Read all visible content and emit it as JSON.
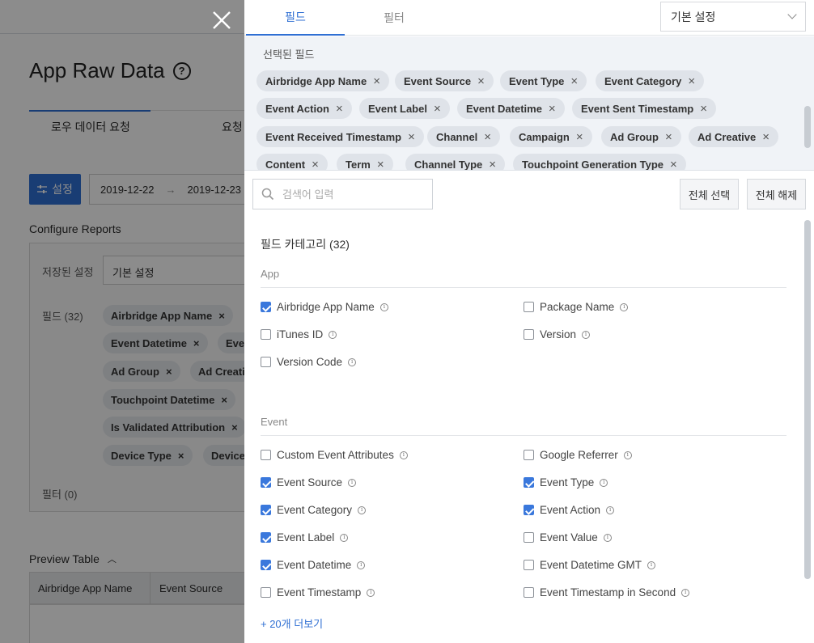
{
  "background": {
    "title": "App Raw Data",
    "tabs": [
      "로우 데이터 요청",
      "요청"
    ],
    "settings_button": "설정",
    "date_start": "2019-12-22",
    "date_end": "2019-12-23",
    "configure_reports": "Configure Reports",
    "saved_settings_label": "저장된 설정",
    "saved_settings_value": "기본 설정",
    "fields_label": "필드 (32)",
    "filter_label": "필터 (0)",
    "chips": [
      "Airbridge App Name",
      "Event Datetime",
      "Even",
      "Ad Group",
      "Ad Creati",
      "Touchpoint Datetime",
      "Is Validated Attribution",
      "Device Type",
      "Device"
    ],
    "preview_table": "Preview Table",
    "table_headers": [
      "Airbridge App Name",
      "Event Source"
    ]
  },
  "drawer": {
    "tabs": [
      "필드",
      "필터"
    ],
    "preset": "기본 설정",
    "selected_label": "선택된 필드",
    "selected_chips": [
      "Airbridge App Name",
      "Event Source",
      "Event Type",
      "Event Category",
      "Event Action",
      "Event Label",
      "Event Datetime",
      "Event Sent Timestamp",
      "Event Received Timestamp",
      "Channel",
      "Campaign",
      "Ad Group",
      "Ad Creative",
      "Content",
      "Term",
      "Channel Type",
      "Touchpoint Generation Type"
    ],
    "search": {
      "placeholder": "검색어 입력"
    },
    "select_all": "전체 선택",
    "deselect_all": "전체 해제",
    "category_heading": "필드 카테고리 (32)",
    "sections": [
      {
        "name": "App",
        "fields": [
          {
            "label": "Airbridge App Name",
            "checked": true
          },
          {
            "label": "Package Name",
            "checked": false
          },
          {
            "label": "iTunes ID",
            "checked": false
          },
          {
            "label": "Version",
            "checked": false
          },
          {
            "label": "Version Code",
            "checked": false
          }
        ]
      },
      {
        "name": "Event",
        "fields": [
          {
            "label": "Custom Event Attributes",
            "checked": false
          },
          {
            "label": "Google Referrer",
            "checked": false
          },
          {
            "label": "Event Source",
            "checked": true
          },
          {
            "label": "Event Type",
            "checked": true
          },
          {
            "label": "Event Category",
            "checked": true
          },
          {
            "label": "Event Action",
            "checked": true
          },
          {
            "label": "Event Label",
            "checked": true
          },
          {
            "label": "Event Value",
            "checked": false
          },
          {
            "label": "Event Datetime",
            "checked": true
          },
          {
            "label": "Event Datetime GMT",
            "checked": false
          },
          {
            "label": "Event Timestamp",
            "checked": false
          },
          {
            "label": "Event Timestamp in Second",
            "checked": false
          }
        ]
      }
    ],
    "more_link": "+ 20개 더보기"
  },
  "colors": {
    "accent": "#2f6fd3",
    "checkbox": "#3a78dc",
    "chip": "#dfe3e9"
  }
}
